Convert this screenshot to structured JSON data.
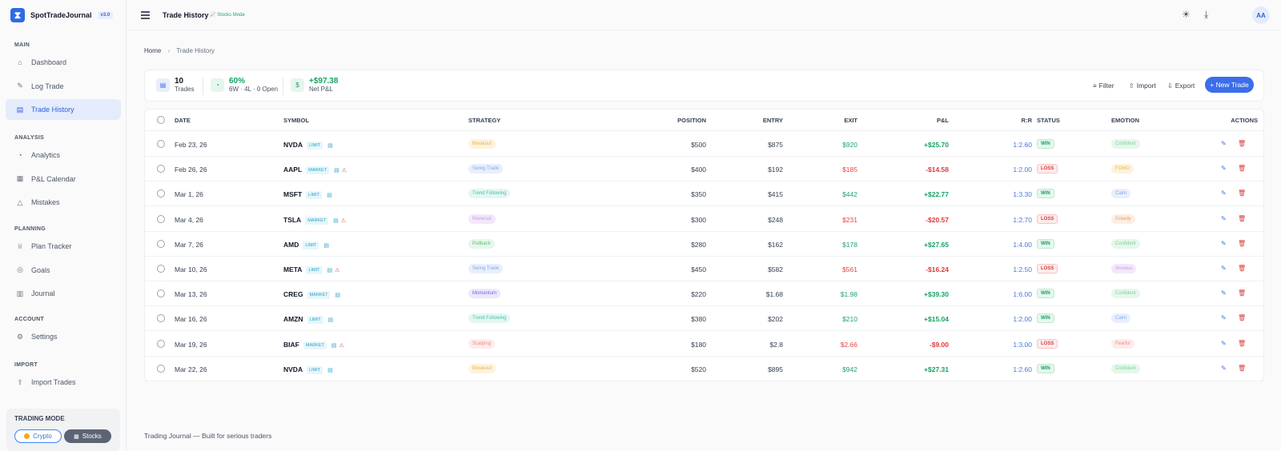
{
  "app": {
    "name": "SpotTradeJournal",
    "version": "v3.0"
  },
  "sidebar": {
    "sections": [
      {
        "label": "MAIN",
        "items": [
          {
            "label": "Dashboard",
            "icon": "home-icon",
            "glyph": "⌂"
          },
          {
            "label": "Log Trade",
            "icon": "edit-icon",
            "glyph": "✎"
          },
          {
            "label": "Trade History",
            "icon": "clipboard-icon",
            "glyph": "▤",
            "active": true
          }
        ]
      },
      {
        "label": "ANALYSIS",
        "items": [
          {
            "label": "Analytics",
            "icon": "pie-chart-icon",
            "glyph": "◔"
          },
          {
            "label": "P&L Calendar",
            "icon": "calendar-icon",
            "glyph": "▦"
          },
          {
            "label": "Mistakes",
            "icon": "warning-icon",
            "glyph": "△"
          }
        ]
      },
      {
        "label": "PLANNING",
        "items": [
          {
            "label": "Plan Tracker",
            "icon": "trophy-icon",
            "glyph": "♕"
          },
          {
            "label": "Goals",
            "icon": "target-icon",
            "glyph": "◎"
          },
          {
            "label": "Journal",
            "icon": "book-icon",
            "glyph": "▥"
          }
        ]
      },
      {
        "label": "ACCOUNT",
        "items": [
          {
            "label": "Settings",
            "icon": "gear-icon",
            "glyph": "⚙"
          }
        ]
      },
      {
        "label": "IMPORT",
        "items": [
          {
            "label": "Import Trades",
            "icon": "upload-icon",
            "glyph": "⇧"
          }
        ]
      }
    ],
    "trading_mode": {
      "title": "TRADING MODE",
      "crypto_label": "Crypto",
      "stocks_label": "Stocks",
      "selected": "Stocks"
    }
  },
  "topbar": {
    "title": "Trade History",
    "mode_badge": "📈 Stocks Mode",
    "avatar": "AA"
  },
  "breadcrumb": {
    "home": "Home",
    "current": "Trade History"
  },
  "stats": {
    "trades_value": "10",
    "trades_label": "Trades",
    "winrate_value": "60%",
    "winrate_label": "6W · 4L · 0 Open",
    "pnl_value": "+$97.38",
    "pnl_label": "Net P&L",
    "pnl_icon": "$",
    "filter": "Filter",
    "import": "Import",
    "export": "Export",
    "new_trade": "+ New Trade"
  },
  "table": {
    "headers": {
      "date": "DATE",
      "symbol": "SYMBOL",
      "strategy": "STRATEGY",
      "position": "POSITION",
      "entry": "ENTRY",
      "exit": "EXIT",
      "pnl": "P&L",
      "rr": "R:R",
      "status": "STATUS",
      "emotion": "EMOTION",
      "actions": "ACTIONS"
    },
    "rows": [
      {
        "date": "Feb 23, 26",
        "symbol": "NVDA",
        "order_type": "LIMIT",
        "warning": false,
        "strategy": "Breakout",
        "position": "$500",
        "entry": "$875",
        "exit": "$920",
        "pnl": "+$25.70",
        "rr": "1:2.60",
        "status": "WIN",
        "emotion": "Confident"
      },
      {
        "date": "Feb 26, 26",
        "symbol": "AAPL",
        "order_type": "MARKET",
        "warning": true,
        "strategy": "Swing Trade",
        "position": "$400",
        "entry": "$192",
        "exit": "$185",
        "pnl": "-$14.58",
        "rr": "1:2.00",
        "status": "LOSS",
        "emotion": "FOMO"
      },
      {
        "date": "Mar 1, 26",
        "symbol": "MSFT",
        "order_type": "LIMIT",
        "warning": false,
        "strategy": "Trend Following",
        "position": "$350",
        "entry": "$415",
        "exit": "$442",
        "pnl": "+$22.77",
        "rr": "1:3.30",
        "status": "WIN",
        "emotion": "Calm"
      },
      {
        "date": "Mar 4, 26",
        "symbol": "TSLA",
        "order_type": "MARKET",
        "warning": true,
        "strategy": "Reversal",
        "position": "$300",
        "entry": "$248",
        "exit": "$231",
        "pnl": "-$20.57",
        "rr": "1:2.70",
        "status": "LOSS",
        "emotion": "Greedy"
      },
      {
        "date": "Mar 7, 26",
        "symbol": "AMD",
        "order_type": "LIMIT",
        "warning": false,
        "strategy": "Pullback",
        "position": "$280",
        "entry": "$162",
        "exit": "$178",
        "pnl": "+$27.65",
        "rr": "1:4.00",
        "status": "WIN",
        "emotion": "Confident"
      },
      {
        "date": "Mar 10, 26",
        "symbol": "META",
        "order_type": "LIMIT",
        "warning": true,
        "strategy": "Swing Trade",
        "position": "$450",
        "entry": "$582",
        "exit": "$561",
        "pnl": "-$16.24",
        "rr": "1:2.50",
        "status": "LOSS",
        "emotion": "Anxious"
      },
      {
        "date": "Mar 13, 26",
        "symbol": "CREG",
        "order_type": "MARKET",
        "warning": false,
        "strategy": "Momentum",
        "position": "$220",
        "entry": "$1.68",
        "exit": "$1.98",
        "pnl": "+$39.30",
        "rr": "1:6.00",
        "status": "WIN",
        "emotion": "Confident"
      },
      {
        "date": "Mar 16, 26",
        "symbol": "AMZN",
        "order_type": "LIMIT",
        "warning": false,
        "strategy": "Trend Following",
        "position": "$380",
        "entry": "$202",
        "exit": "$210",
        "pnl": "+$15.04",
        "rr": "1:2.00",
        "status": "WIN",
        "emotion": "Calm"
      },
      {
        "date": "Mar 19, 26",
        "symbol": "BIAF",
        "order_type": "MARKET",
        "warning": true,
        "strategy": "Scalping",
        "position": "$180",
        "entry": "$2.8",
        "exit": "$2.66",
        "pnl": "-$9.00",
        "rr": "1:3.00",
        "status": "LOSS",
        "emotion": "Fearful"
      },
      {
        "date": "Mar 22, 26",
        "symbol": "NVDA",
        "order_type": "LIMIT",
        "warning": false,
        "strategy": "Breakout",
        "position": "$520",
        "entry": "$895",
        "exit": "$942",
        "pnl": "+$27.31",
        "rr": "1:2.60",
        "status": "WIN",
        "emotion": "Confident"
      }
    ]
  },
  "strategy_colors": {
    "Breakout": [
      "#fdf3dc",
      "#e9b64b"
    ],
    "Swing Trade": [
      "#e8effc",
      "#8aa8e8"
    ],
    "Trend Following": [
      "#e3f7f3",
      "#45c2a8"
    ],
    "Reversal": [
      "#f3e8fb",
      "#c79be6"
    ],
    "Pullback": [
      "#e6f7ea",
      "#59c27a"
    ],
    "Momentum": [
      "#ece8fc",
      "#7b63d8"
    ],
    "Scalping": [
      "#fdeceb",
      "#ee8c86"
    ]
  },
  "emotion_colors": {
    "Confident": [
      "#e6f7ea",
      "#7fd0a0"
    ],
    "FOMO": [
      "#fdf3dc",
      "#e9b64b"
    ],
    "Calm": [
      "#e8effc",
      "#8aa8e8"
    ],
    "Greedy": [
      "#fdeee3",
      "#ec9d6b"
    ],
    "Anxious": [
      "#f3e8fb",
      "#c79be6"
    ],
    "Fearful": [
      "#fdeceb",
      "#ee8c86"
    ]
  },
  "footer": "Trading Journal — Built for serious traders"
}
